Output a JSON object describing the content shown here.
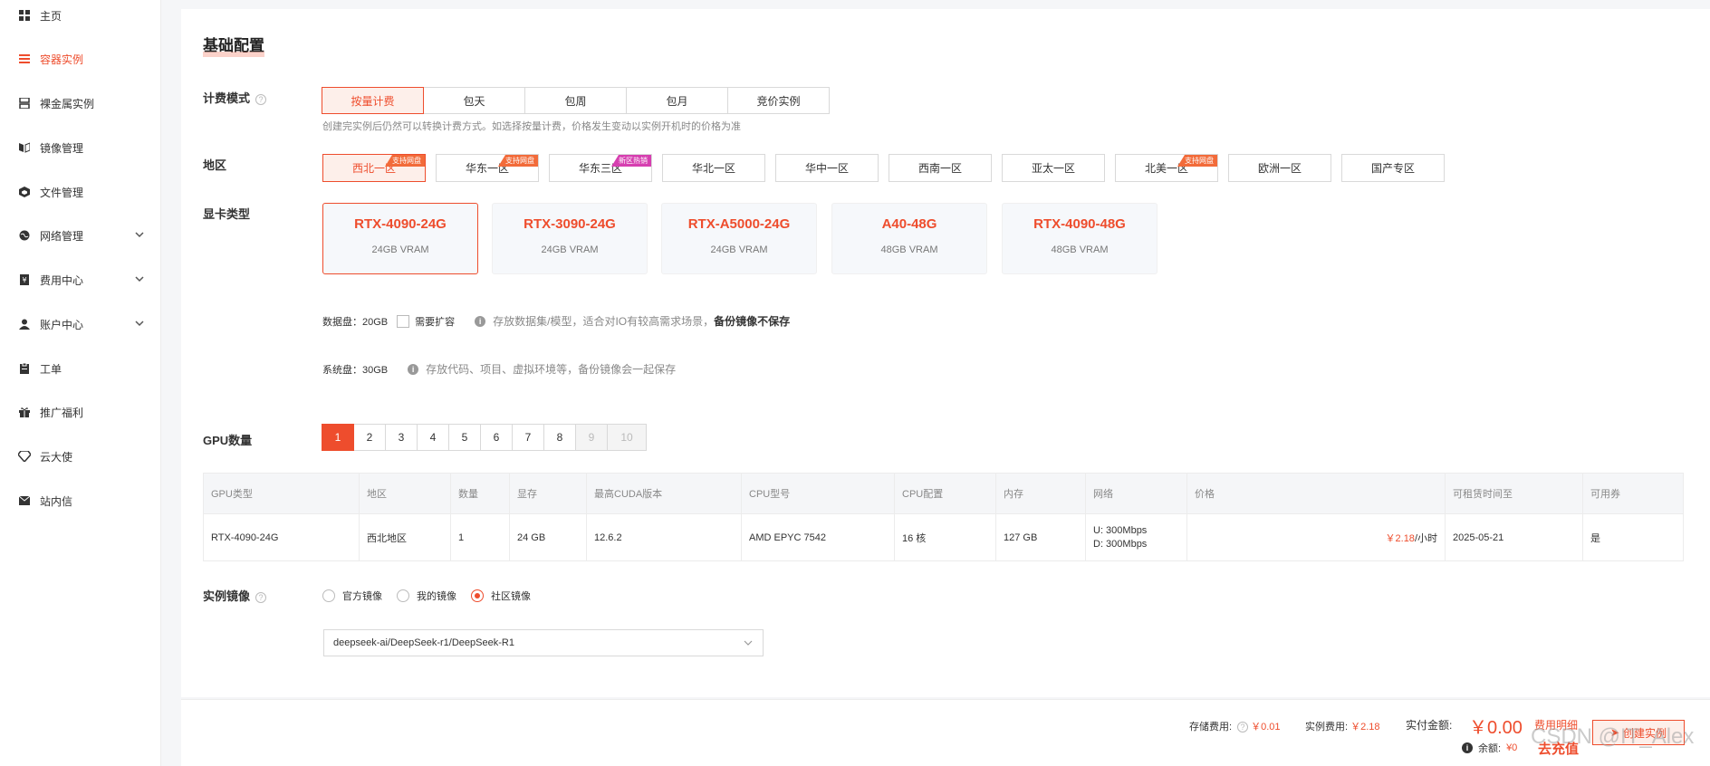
{
  "sidebar": {
    "items": [
      {
        "label": "主页",
        "icon": "grid-icon"
      },
      {
        "label": "容器实例",
        "icon": "list-icon",
        "active": true
      },
      {
        "label": "裸金属实例",
        "icon": "server-icon"
      },
      {
        "label": "镜像管理",
        "icon": "mirror-icon"
      },
      {
        "label": "文件管理",
        "icon": "box-icon"
      },
      {
        "label": "网络管理",
        "icon": "globe-icon",
        "expandable": true
      },
      {
        "label": "费用中心",
        "icon": "bill-icon",
        "expandable": true
      },
      {
        "label": "账户中心",
        "icon": "user-icon",
        "expandable": true
      },
      {
        "label": "工单",
        "icon": "clipboard-icon"
      },
      {
        "label": "推广福利",
        "icon": "gift-icon"
      },
      {
        "label": "云大使",
        "icon": "diamond-icon"
      },
      {
        "label": "站内信",
        "icon": "mail-icon"
      }
    ]
  },
  "section_title": "基础配置",
  "billing": {
    "label": "计费模式",
    "options": [
      "按量计费",
      "包天",
      "包周",
      "包月",
      "竞价实例"
    ],
    "selected": 0,
    "hint": "创建完实例后仍然可以转换计费方式。如选择按量计费，价格发生变动以实例开机时的价格为准"
  },
  "region": {
    "label": "地区",
    "options": [
      {
        "name": "西北一区",
        "tag": "支持网盘",
        "tag_color": "#f26b3a"
      },
      {
        "name": "华东一区",
        "tag": "支持网盘",
        "tag_color": "#f26b3a"
      },
      {
        "name": "华东三区",
        "tag": "新区热销",
        "tag_color": "#d63fb0"
      },
      {
        "name": "华北一区",
        "tag": ""
      },
      {
        "name": "华中一区",
        "tag": ""
      },
      {
        "name": "西南一区",
        "tag": ""
      },
      {
        "name": "亚太一区",
        "tag": ""
      },
      {
        "name": "北美一区",
        "tag": "支持网盘",
        "tag_color": "#f26b3a"
      },
      {
        "name": "欧洲一区",
        "tag": ""
      },
      {
        "name": "国产专区",
        "tag": ""
      }
    ],
    "selected": 0
  },
  "gpu_type": {
    "label": "显卡类型",
    "options": [
      {
        "name": "RTX-4090-24G",
        "vram": "24GB VRAM"
      },
      {
        "name": "RTX-3090-24G",
        "vram": "24GB VRAM"
      },
      {
        "name": "RTX-A5000-24G",
        "vram": "24GB VRAM"
      },
      {
        "name": "A40-48G",
        "vram": "48GB VRAM"
      },
      {
        "name": "RTX-4090-48G",
        "vram": "48GB VRAM"
      }
    ],
    "selected": 0
  },
  "data_disk": {
    "label": "数据盘：20GB",
    "checkbox_label": "需要扩容",
    "note": "存放数据集/模型，适合对IO有较高需求场景，",
    "note_bold": "备份镜像不保存"
  },
  "system_disk": {
    "label": "系统盘：30GB",
    "note": "存放代码、项目、虚拟环境等，备份镜像会一起保存"
  },
  "gpu_count": {
    "label": "GPU数量",
    "options": [
      "1",
      "2",
      "3",
      "4",
      "5",
      "6",
      "7",
      "8",
      "9",
      "10"
    ],
    "selected": 0,
    "disabled": [
      "9",
      "10"
    ]
  },
  "table": {
    "headers": [
      "GPU类型",
      "地区",
      "数量",
      "显存",
      "最高CUDA版本",
      "CPU型号",
      "CPU配置",
      "内存",
      "网络",
      "价格",
      "可租赁时间至",
      "可用券"
    ],
    "row": {
      "gpu": "RTX-4090-24G",
      "region": "西北地区",
      "count": "1",
      "vram": "24 GB",
      "cuda": "12.6.2",
      "cpu": "AMD EPYC 7542",
      "cpu_cfg": "16 核",
      "mem": "127 GB",
      "net_up": "U: 300Mbps",
      "net_down": "D: 300Mbps",
      "price": "￥2.18",
      "price_unit": "/小时",
      "until": "2025-05-21",
      "coupon": "是"
    }
  },
  "image": {
    "label": "实例镜像",
    "options": [
      "官方镜像",
      "我的镜像",
      "社区镜像"
    ],
    "selected": 2,
    "value": "deepseek-ai/DeepSeek-r1/DeepSeek-R1"
  },
  "footer": {
    "storage_label": "存储费用:",
    "storage_value": "￥0.01",
    "instance_label": "实例费用:",
    "instance_value": "￥2.18",
    "pay_label": "实付金额:",
    "pay_value": "￥0.00",
    "detail_link": "费用明细",
    "balance_label": "余额:",
    "balance_value": "¥0",
    "recharge": "去充值",
    "create_button": "创建实例",
    "watermark": "CSDN @IT_Alex"
  },
  "colors": {
    "accent": "#ee4d2d"
  }
}
